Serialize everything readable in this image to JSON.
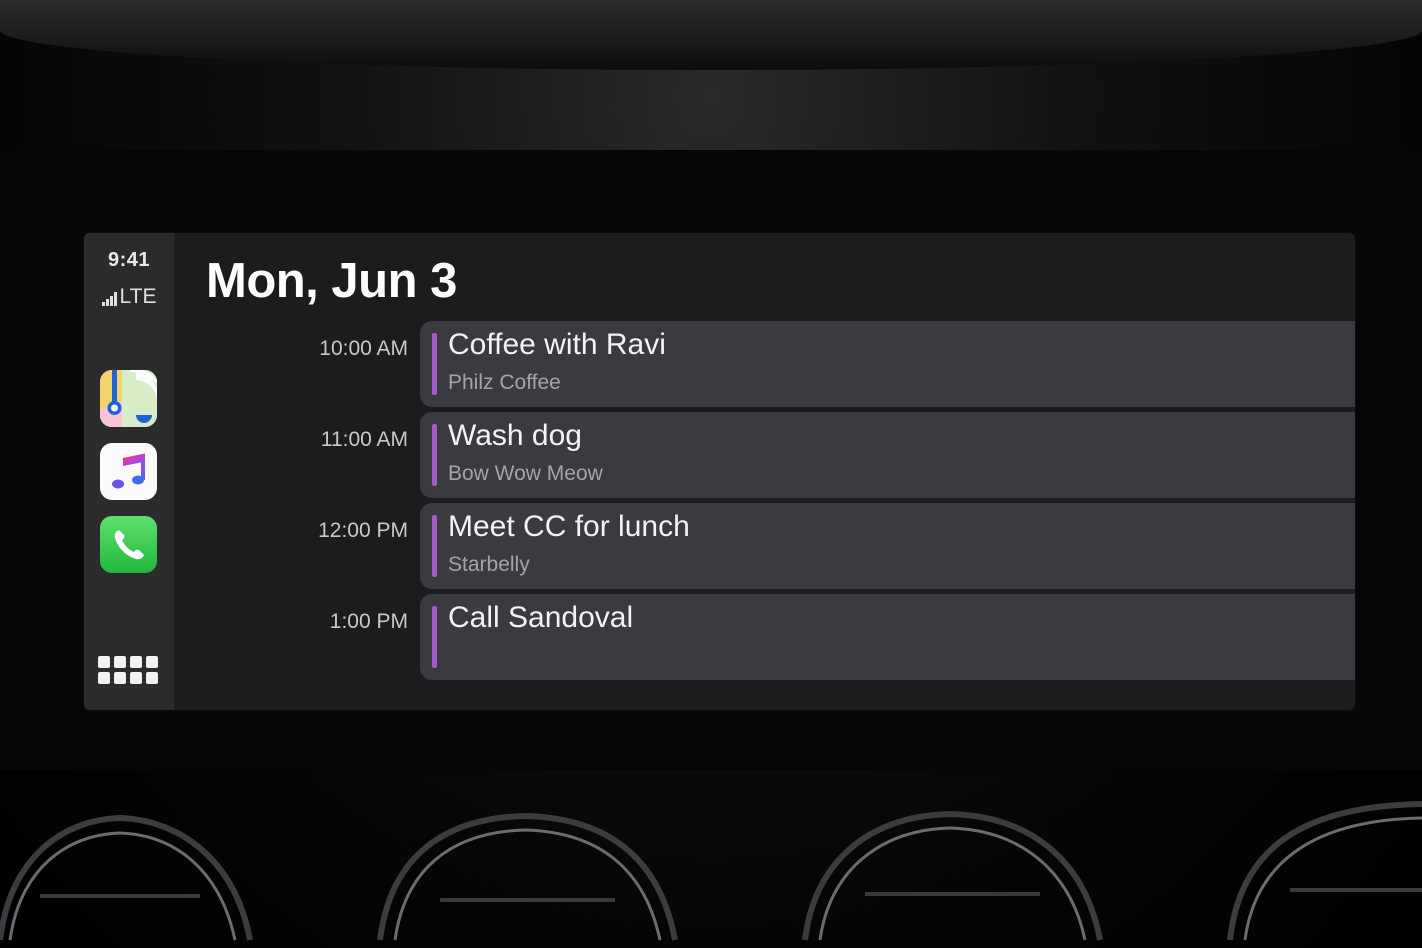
{
  "status": {
    "time": "9:41",
    "network": "LTE",
    "signal_bars": 4
  },
  "dock": {
    "apps": [
      {
        "name": "Maps",
        "icon": "maps-icon"
      },
      {
        "name": "Music",
        "icon": "music-note-icon"
      },
      {
        "name": "Phone",
        "icon": "phone-icon"
      }
    ],
    "app_grid_icon": "app-grid-icon"
  },
  "calendar": {
    "date_title": "Mon, Jun 3",
    "accent_color": "#a25bc8",
    "events": [
      {
        "time": "10:00 AM",
        "title": "Coffee with Ravi",
        "location": "Philz Coffee"
      },
      {
        "time": "11:00 AM",
        "title": "Wash dog",
        "location": "Bow Wow Meow"
      },
      {
        "time": "12:00 PM",
        "title": "Meet CC for lunch",
        "location": "Starbelly"
      },
      {
        "time": "1:00 PM",
        "title": "Call Sandoval",
        "location": ""
      }
    ]
  }
}
